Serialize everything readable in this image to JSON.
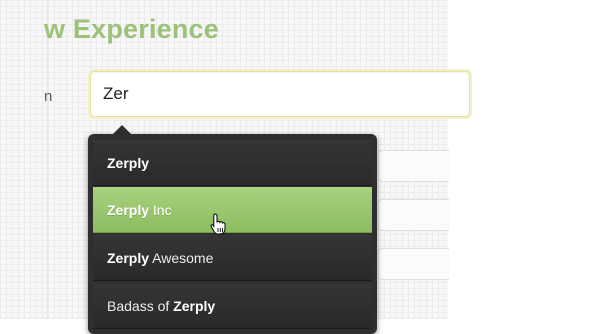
{
  "page": {
    "title": "w Experience",
    "label_fragment": "n"
  },
  "search": {
    "value": "Zer"
  },
  "dropdown": {
    "items": [
      {
        "pre": "",
        "match": "Zerply",
        "post": "",
        "active": false
      },
      {
        "pre": "",
        "match": "Zerply",
        "post": " Inc",
        "active": true
      },
      {
        "pre": "",
        "match": "Zerply",
        "post": " Awesome",
        "active": false
      },
      {
        "pre": "Badass of ",
        "match": "Zerply",
        "post": "",
        "active": false
      }
    ]
  },
  "colors": {
    "title_green": "#9cc27a",
    "active_item_green": "#9ccb70",
    "dropdown_bg": "#2f2f2f"
  },
  "icons": {
    "cursor": "hand-pointer-icon"
  }
}
